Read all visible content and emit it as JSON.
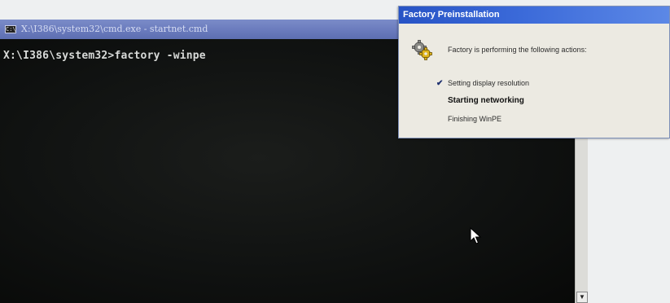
{
  "cmd_window": {
    "title": "X:\\I386\\system32\\cmd.exe - startnet.cmd",
    "system_icon_label": "C:\\",
    "prompt_line": "X:\\I386\\system32>factory -winpe"
  },
  "factory_dialog": {
    "title": "Factory Preinstallation",
    "intro": "Factory is performing the following actions:",
    "actions": [
      {
        "label": "Setting display resolution",
        "status": "done"
      },
      {
        "label": "Starting networking",
        "status": "in-progress"
      },
      {
        "label": "Finishing WinPE",
        "status": "pending"
      }
    ]
  },
  "icons": {
    "cmd_system_icon": "console-icon",
    "dialog_icon": "gears-icon",
    "done_marker": "check-icon",
    "scroll_down": "arrow-down-icon",
    "pointer": "mouse-cursor-icon"
  },
  "colors": {
    "console_background": "#0c0e0d",
    "console_text": "#d8dad8",
    "console_titlebar": "#6a7bbd",
    "dialog_titlebar": "#2753c5",
    "dialog_background": "#eceae2"
  }
}
